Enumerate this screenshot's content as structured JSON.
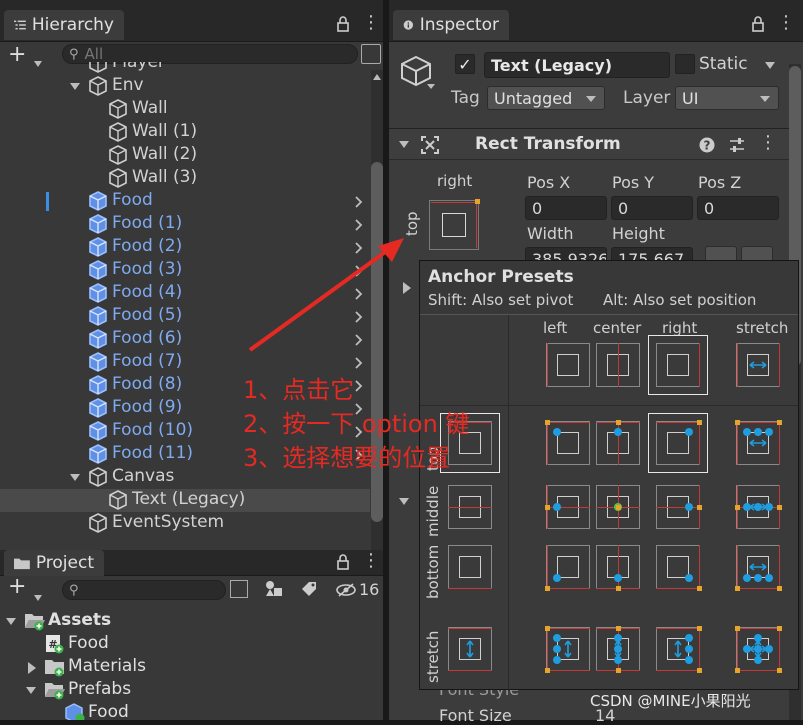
{
  "hierarchy": {
    "tab_label": "Hierarchy",
    "search_placeholder": "All",
    "rows": [
      {
        "label": "Player",
        "indent": 1,
        "blue": false,
        "expand": "none",
        "chev": false
      },
      {
        "label": "Env",
        "indent": 1,
        "blue": false,
        "expand": "open",
        "chev": false
      },
      {
        "label": "Wall",
        "indent": 2,
        "blue": false,
        "expand": "none",
        "chev": false
      },
      {
        "label": "Wall (1)",
        "indent": 2,
        "blue": false,
        "expand": "none",
        "chev": false
      },
      {
        "label": "Wall (2)",
        "indent": 2,
        "blue": false,
        "expand": "none",
        "chev": false
      },
      {
        "label": "Wall (3)",
        "indent": 2,
        "blue": false,
        "expand": "none",
        "chev": false
      },
      {
        "label": "Food",
        "indent": 1,
        "blue": true,
        "expand": "none",
        "chev": true
      },
      {
        "label": "Food (1)",
        "indent": 1,
        "blue": true,
        "expand": "none",
        "chev": true
      },
      {
        "label": "Food (2)",
        "indent": 1,
        "blue": true,
        "expand": "none",
        "chev": true
      },
      {
        "label": "Food (3)",
        "indent": 1,
        "blue": true,
        "expand": "none",
        "chev": true
      },
      {
        "label": "Food (4)",
        "indent": 1,
        "blue": true,
        "expand": "none",
        "chev": true
      },
      {
        "label": "Food (5)",
        "indent": 1,
        "blue": true,
        "expand": "none",
        "chev": true
      },
      {
        "label": "Food (6)",
        "indent": 1,
        "blue": true,
        "expand": "none",
        "chev": true
      },
      {
        "label": "Food (7)",
        "indent": 1,
        "blue": true,
        "expand": "none",
        "chev": true
      },
      {
        "label": "Food (8)",
        "indent": 1,
        "blue": true,
        "expand": "none",
        "chev": true
      },
      {
        "label": "Food (9)",
        "indent": 1,
        "blue": true,
        "expand": "none",
        "chev": true
      },
      {
        "label": "Food (10)",
        "indent": 1,
        "blue": true,
        "expand": "none",
        "chev": true
      },
      {
        "label": "Food (11)",
        "indent": 1,
        "blue": true,
        "expand": "none",
        "chev": true
      },
      {
        "label": "Canvas",
        "indent": 1,
        "blue": false,
        "expand": "open",
        "chev": false
      },
      {
        "label": "Text (Legacy)",
        "indent": 2,
        "blue": false,
        "expand": "none",
        "chev": false,
        "selected": true
      },
      {
        "label": "EventSystem",
        "indent": 1,
        "blue": false,
        "expand": "none",
        "chev": false
      }
    ]
  },
  "project": {
    "tab_label": "Project",
    "hidden_count": "16",
    "rows": [
      {
        "label": "Assets",
        "indent": 0,
        "type": "folder-open",
        "bold": true,
        "expand": "open"
      },
      {
        "label": "Food",
        "indent": 1,
        "type": "script",
        "bold": false,
        "expand": "none"
      },
      {
        "label": "Materials",
        "indent": 1,
        "type": "folder",
        "bold": false,
        "expand": "closed"
      },
      {
        "label": "Prefabs",
        "indent": 1,
        "type": "folder-open",
        "bold": false,
        "expand": "open"
      },
      {
        "label": "Food",
        "indent": 2,
        "type": "prefab",
        "bold": false,
        "expand": "none"
      }
    ]
  },
  "inspector": {
    "tab_label": "Inspector",
    "object_name": "Text (Legacy)",
    "static_label": "Static",
    "tag_label": "Tag",
    "tag_value": "Untagged",
    "layer_label": "Layer",
    "layer_value": "UI",
    "component_title": "Rect Transform",
    "anchor_h": "right",
    "anchor_v": "top",
    "pos_x_label": "Pos X",
    "pos_y_label": "Pos Y",
    "pos_z_label": "Pos Z",
    "pos_x": "0",
    "pos_y": "0",
    "pos_z": "0",
    "width_label": "Width",
    "height_label": "Height",
    "width_value": "385.9326",
    "height_value": "175.667",
    "font_style_label": "Font Style",
    "font_size_label": "Font Size",
    "font_size_value": "14"
  },
  "anchor_presets": {
    "title": "Anchor Presets",
    "hint_shift": "Shift: Also set pivot",
    "hint_alt": "Alt: Also set position",
    "columns": [
      "left",
      "center",
      "right",
      "stretch"
    ],
    "rows": [
      "top",
      "middle",
      "bottom",
      "stretch"
    ]
  },
  "annotations": {
    "step1": "1、点击它",
    "step2": "2、按一下 option 键",
    "step3": "3、选择想要的位置",
    "arrow_color": "#e42a22"
  },
  "watermark": "CSDN @MINE小果阳光",
  "colors": {
    "prefab_blue": "#7faaf0",
    "anchor_blue": "#1e9de0",
    "anchor_red": "#c23a3a",
    "anchor_orange": "#e5a52a"
  }
}
